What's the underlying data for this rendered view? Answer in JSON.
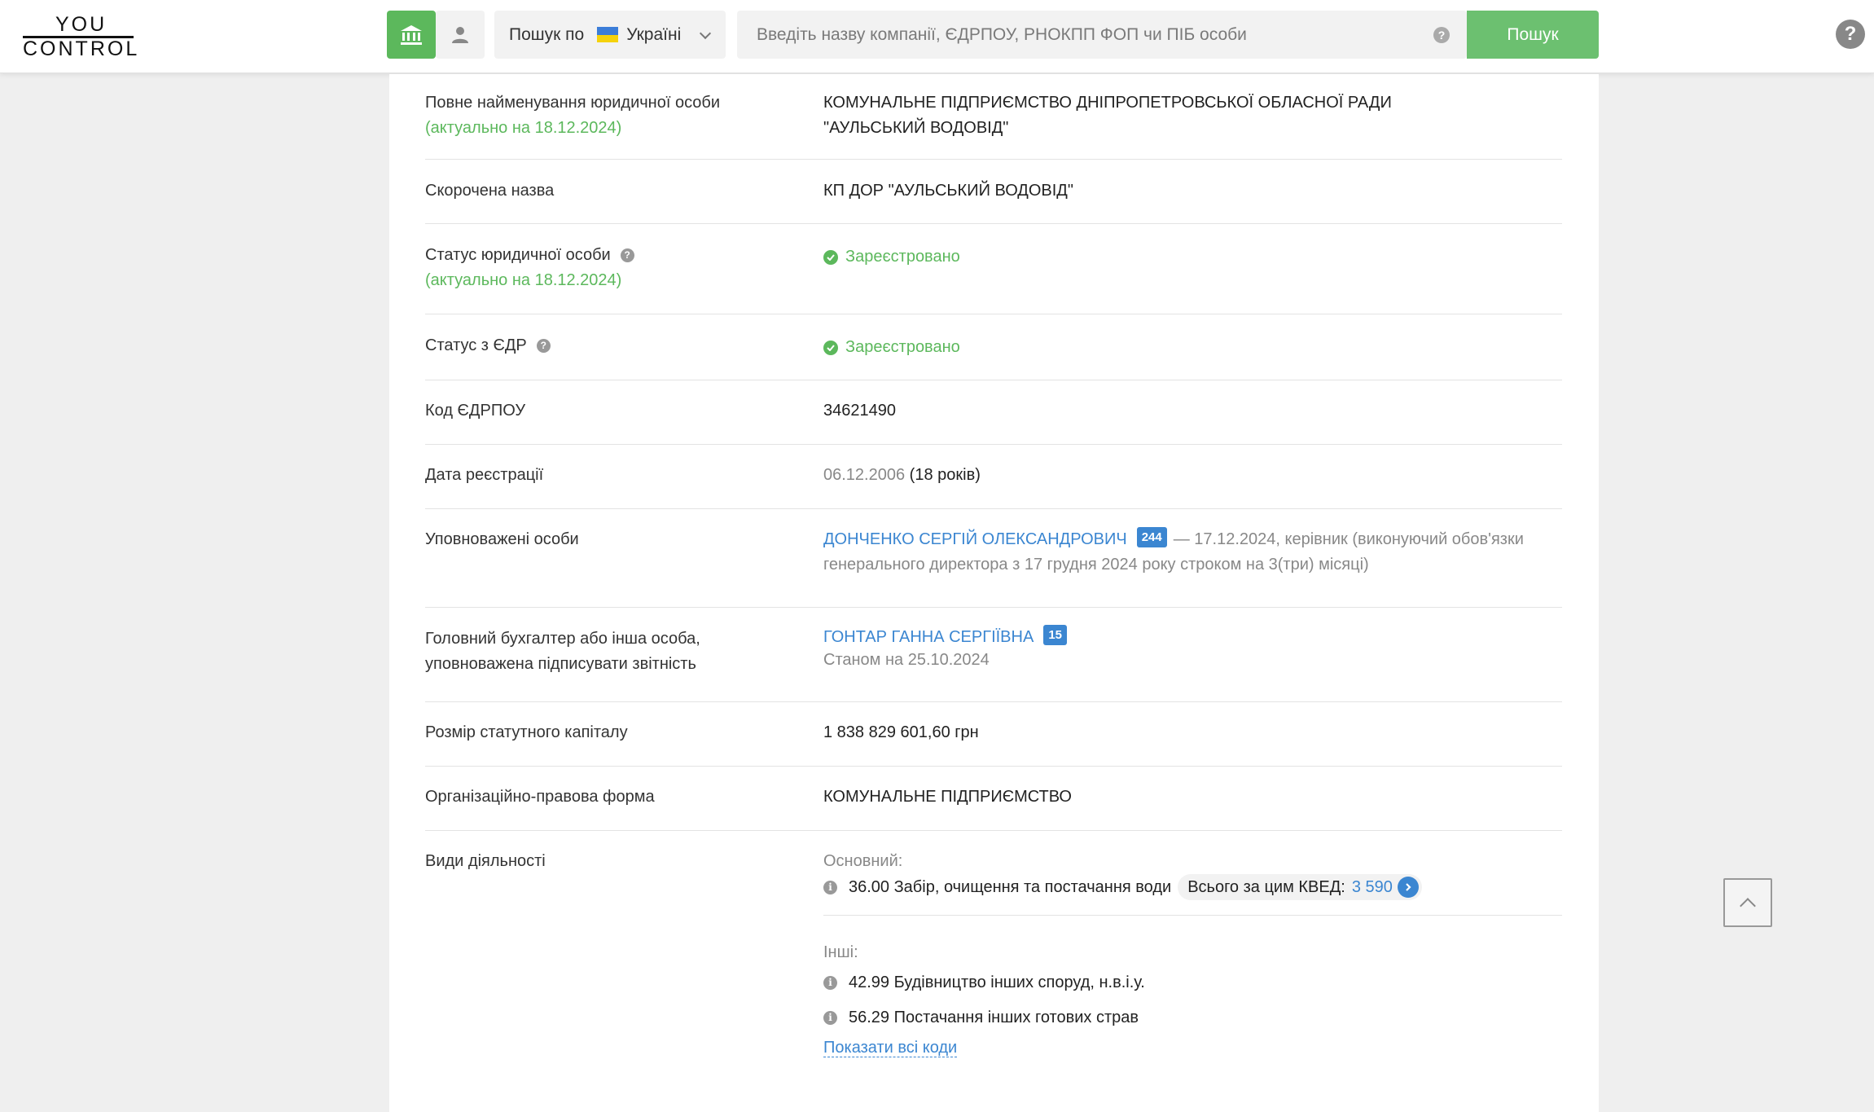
{
  "header": {
    "logo_top": "YOU",
    "logo_bottom": "CONTROL",
    "country_prefix": "Пошук по",
    "country_value": "Україні",
    "search_placeholder": "Введіть назву компанії, ЄДРПОУ, РНОКПП ФОП чи ПІБ особи",
    "search_help": "?",
    "search_button": "Пошук",
    "help_button": "?"
  },
  "company": {
    "full_name_label": "Повне найменування юридичної особи",
    "full_name_actual": "(актуально на 18.12.2024)",
    "full_name_line1": "КОМУНАЛЬНЕ ПІДПРИЄМСТВО ДНІПРОПЕТРОВСЬКОЇ ОБЛАСНОЇ РАДИ",
    "full_name_line2": "\"АУЛЬСЬКИЙ ВОДОВІД\"",
    "short_name_label": "Скорочена назва",
    "short_name": "КП ДОР \"АУЛЬСЬКИЙ ВОДОВІД\"",
    "status_label": "Статус юридичної особи",
    "status_actual": "(актуально на 18.12.2024)",
    "status_value": "Зареєстровано",
    "edr_status_label": "Статус з ЄДР",
    "edr_status_value": "Зареєстровано",
    "edrpou_label": "Код ЄДРПОУ",
    "edrpou": "34621490",
    "reg_date_label": "Дата реєстрації",
    "reg_date": "06.12.2006",
    "reg_age": "(18 років)",
    "authorized_label": "Уповноважені особи",
    "authorized_name": "ДОНЧЕНКО СЕРГІЙ ОЛЕКСАНДРОВИЧ",
    "authorized_badge": "244",
    "authorized_note_line1": "— 17.12.2024, керівник (виконуючий обов'язки",
    "authorized_note_line2": "генерального директора з 17 грудня 2024 року строком на 3(три) місяці)",
    "accountant_label_line1": "Головний бухгалтер або інша особа,",
    "accountant_label_line2": "уповноважена підписувати звітність",
    "accountant_name": "ГОНТАР ГАННА СЕРГІЇВНА",
    "accountant_badge": "15",
    "accountant_date": "Станом на 25.10.2024",
    "capital_label": "Розмір статутного капіталу",
    "capital": "1 838 829 601,60 грн",
    "legal_form_label": "Організаційно-правова форма",
    "legal_form": "КОМУНАЛЬНЕ ПІДПРИЄМСТВО",
    "activities_label": "Види діяльності",
    "main_activity_title": "Основний:",
    "main_activity": "36.00 Забір, очищення та постачання води",
    "total_label": "Всього за цим КВЕД:",
    "total_count": "3 590",
    "other_title": "Інші:",
    "other_activities": [
      "42.99 Будівництво інших споруд, н.в.і.у.",
      "56.29 Постачання інших готових страв"
    ],
    "show_all": "Показати всі коди"
  },
  "colors": {
    "accent_green": "#5cb85c",
    "link_blue": "#3b86d1"
  }
}
